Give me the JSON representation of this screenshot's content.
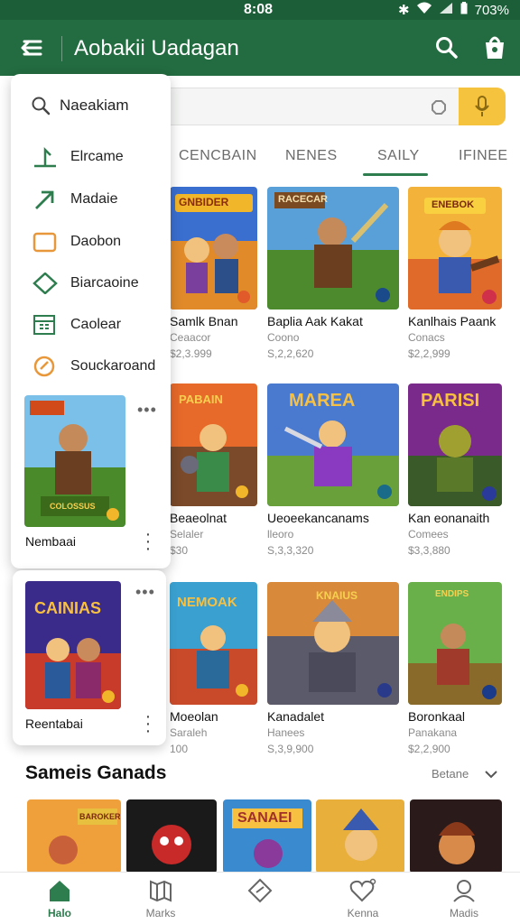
{
  "status_bar": {
    "time": "8:08",
    "battery": "703%"
  },
  "app_bar": {
    "title": "Aobakii Uadagan"
  },
  "search": {
    "placeholder": ""
  },
  "tabs": [
    {
      "label": "CENCBAIN"
    },
    {
      "label": "NENES"
    },
    {
      "label": "SAILY",
      "active": true
    },
    {
      "label": "IFINEE"
    }
  ],
  "drawer": {
    "search_label": "Naeakiam",
    "items": [
      {
        "label": "Elrcame",
        "icon": "trend-icon"
      },
      {
        "label": "Madaie",
        "icon": "arrow-up-right-icon"
      },
      {
        "label": "Daobon",
        "icon": "folder-icon"
      },
      {
        "label": "Biarcaoine",
        "icon": "tag-icon"
      },
      {
        "label": "Caolear",
        "icon": "calendar-icon"
      },
      {
        "label": "Souckaroand",
        "icon": "compass-icon"
      }
    ],
    "card": {
      "title": "Nembaai",
      "badge": "COLOSSUS"
    }
  },
  "card2": {
    "title": "Reentabai",
    "banner": "CAINIAS"
  },
  "games": [
    {
      "title": "Samlk Bnan",
      "subtitle": "Ceaacor",
      "price": "$2,3.999",
      "banner": "GNBIDER"
    },
    {
      "title": "Baplia Aak Kakat",
      "subtitle": "Coono",
      "price": "S,2,2,620",
      "banner": "RACECAR"
    },
    {
      "title": "Kanlhais Paank",
      "subtitle": "Conacs",
      "price": "$2,2,999",
      "banner": "ENEBOK"
    },
    {
      "title": "Beaeolnat",
      "subtitle": "Selaler",
      "price": "$30",
      "banner": "PABAIN"
    },
    {
      "title": "Ueoeekancanams",
      "subtitle": "lleoro",
      "price": "S,3,3,320",
      "banner": "MAREA"
    },
    {
      "title": "Kan eonanaith",
      "subtitle": "Comees",
      "price": "$3,3,880",
      "banner": "PARISI"
    },
    {
      "title": "Moeolan",
      "subtitle": "Saraleh",
      "price": "100",
      "banner": "NEMOAK"
    },
    {
      "title": "Kanadalet",
      "subtitle": "Hanees",
      "price": "S,3,9,900",
      "banner": "KNAIUS"
    },
    {
      "title": "Boronkaal",
      "subtitle": "Panakana",
      "price": "$2,2,900",
      "banner": "ENDIPS"
    }
  ],
  "section": {
    "title": "Sameis Ganads",
    "more_label": "Betane"
  },
  "strip": [
    {
      "banner": "BAROKER"
    },
    {
      "banner": ""
    },
    {
      "banner": "SANAEI"
    },
    {
      "banner": ""
    },
    {
      "banner": ""
    }
  ],
  "bottom_nav": [
    {
      "label": "Halo",
      "icon": "home-icon",
      "active": true
    },
    {
      "label": "Marks",
      "icon": "map-icon"
    },
    {
      "label": "",
      "icon": "tag-icon"
    },
    {
      "label": "Kenna",
      "icon": "heart-icon"
    },
    {
      "label": "Madis",
      "icon": "profile-icon"
    }
  ],
  "colors": {
    "primary": "#236b40",
    "accent": "#f6c33f",
    "tab_active": "#2e7d4f"
  }
}
